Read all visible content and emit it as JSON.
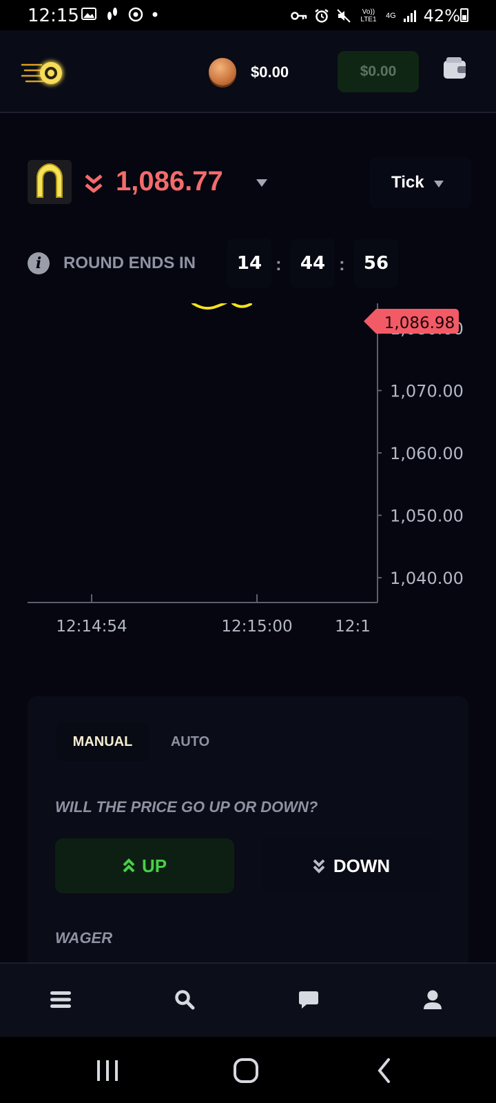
{
  "status_bar": {
    "time": "12:15",
    "battery": "42%",
    "network": "4G",
    "volte": "Vo)) LTE1"
  },
  "header": {
    "balance": "$0.00",
    "deposit_value": "$0.00",
    "icons": [
      "fireball-logo-icon",
      "coin-icon",
      "wallet-icon"
    ]
  },
  "asset": {
    "price": "1,086.77",
    "trend": "down",
    "chart_mode": "Tick"
  },
  "round": {
    "label": "ROUND ENDS IN",
    "hours": "14",
    "minutes": "44",
    "seconds": "56"
  },
  "chart_data": {
    "type": "line",
    "title": "",
    "xlabel": "",
    "ylabel": "",
    "x_ticks": [
      "12:14:54",
      "12:15:00",
      "12:1"
    ],
    "y_ticks": [
      "1,040.00",
      "1,050.00",
      "1,060.00",
      "1,070.00",
      "1,080.00"
    ],
    "ylim": [
      1035,
      1082
    ],
    "current_price_label": "1,086.98",
    "current_price": 1086.98,
    "line_color": "#f5e21c",
    "grid": false
  },
  "trade": {
    "tabs": [
      "MANUAL",
      "AUTO"
    ],
    "active_tab": "MANUAL",
    "question": "WILL THE PRICE GO UP OR DOWN?",
    "up_label": "UP",
    "down_label": "DOWN",
    "wager_label": "WAGER",
    "colors": {
      "up": "#46d145",
      "down": "#f36b6b"
    }
  },
  "bottom_nav": {
    "items": [
      "menu-icon",
      "search-icon",
      "chat-icon",
      "user-icon"
    ]
  }
}
